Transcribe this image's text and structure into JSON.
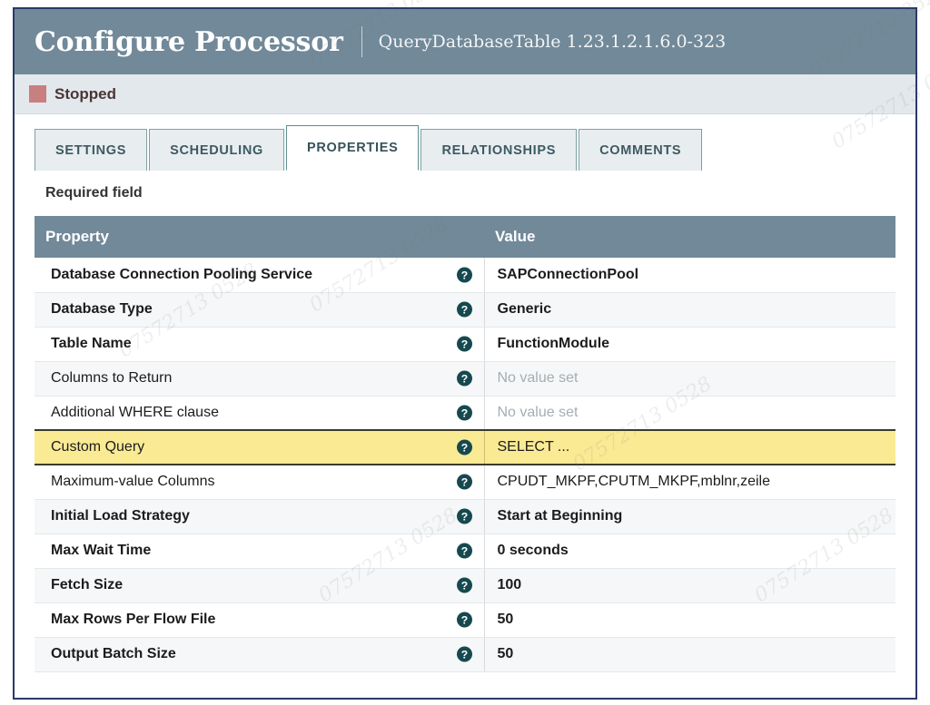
{
  "dialog": {
    "title": "Configure Processor",
    "subtitle": "QueryDatabaseTable 1.23.1.2.1.6.0-323"
  },
  "status": {
    "label": "Stopped",
    "color": "#c87f7f"
  },
  "tabs": [
    {
      "label": "SETTINGS",
      "active": false
    },
    {
      "label": "SCHEDULING",
      "active": false
    },
    {
      "label": "PROPERTIES",
      "active": true
    },
    {
      "label": "RELATIONSHIPS",
      "active": false
    },
    {
      "label": "COMMENTS",
      "active": false
    }
  ],
  "body": {
    "required_note": "Required field"
  },
  "table": {
    "columns": [
      "Property",
      "Value"
    ],
    "help_icon": "help-circle-icon",
    "rows": [
      {
        "property": "Database Connection Pooling Service",
        "value": "SAPConnectionPool",
        "required": true,
        "empty": false,
        "highlight": false
      },
      {
        "property": "Database Type",
        "value": "Generic",
        "required": true,
        "empty": false,
        "highlight": false
      },
      {
        "property": "Table Name",
        "value": "FunctionModule",
        "required": true,
        "empty": false,
        "highlight": false
      },
      {
        "property": "Columns to Return",
        "value": "No value set",
        "required": false,
        "empty": true,
        "highlight": false
      },
      {
        "property": "Additional WHERE clause",
        "value": "No value set",
        "required": false,
        "empty": true,
        "highlight": false
      },
      {
        "property": "Custom Query",
        "value": "SELECT ...",
        "required": false,
        "empty": false,
        "highlight": true
      },
      {
        "property": "Maximum-value Columns",
        "value": "CPUDT_MKPF,CPUTM_MKPF,mblnr,zeile",
        "required": false,
        "empty": false,
        "highlight": false
      },
      {
        "property": "Initial Load Strategy",
        "value": "Start at Beginning",
        "required": true,
        "empty": false,
        "highlight": false
      },
      {
        "property": "Max Wait Time",
        "value": "0 seconds",
        "required": true,
        "empty": false,
        "highlight": false
      },
      {
        "property": "Fetch Size",
        "value": "100",
        "required": true,
        "empty": false,
        "highlight": false
      },
      {
        "property": "Max Rows Per Flow File",
        "value": "50",
        "required": true,
        "empty": false,
        "highlight": false
      },
      {
        "property": "Output Batch Size",
        "value": "50",
        "required": true,
        "empty": false,
        "highlight": false
      }
    ]
  },
  "watermarks": [
    "07572713 0528",
    "07572713 0528",
    "07572713 0528",
    "07572713 0528",
    "07572713 0528",
    "07572713 0528",
    "07572713 0528",
    "07572713 0528"
  ]
}
